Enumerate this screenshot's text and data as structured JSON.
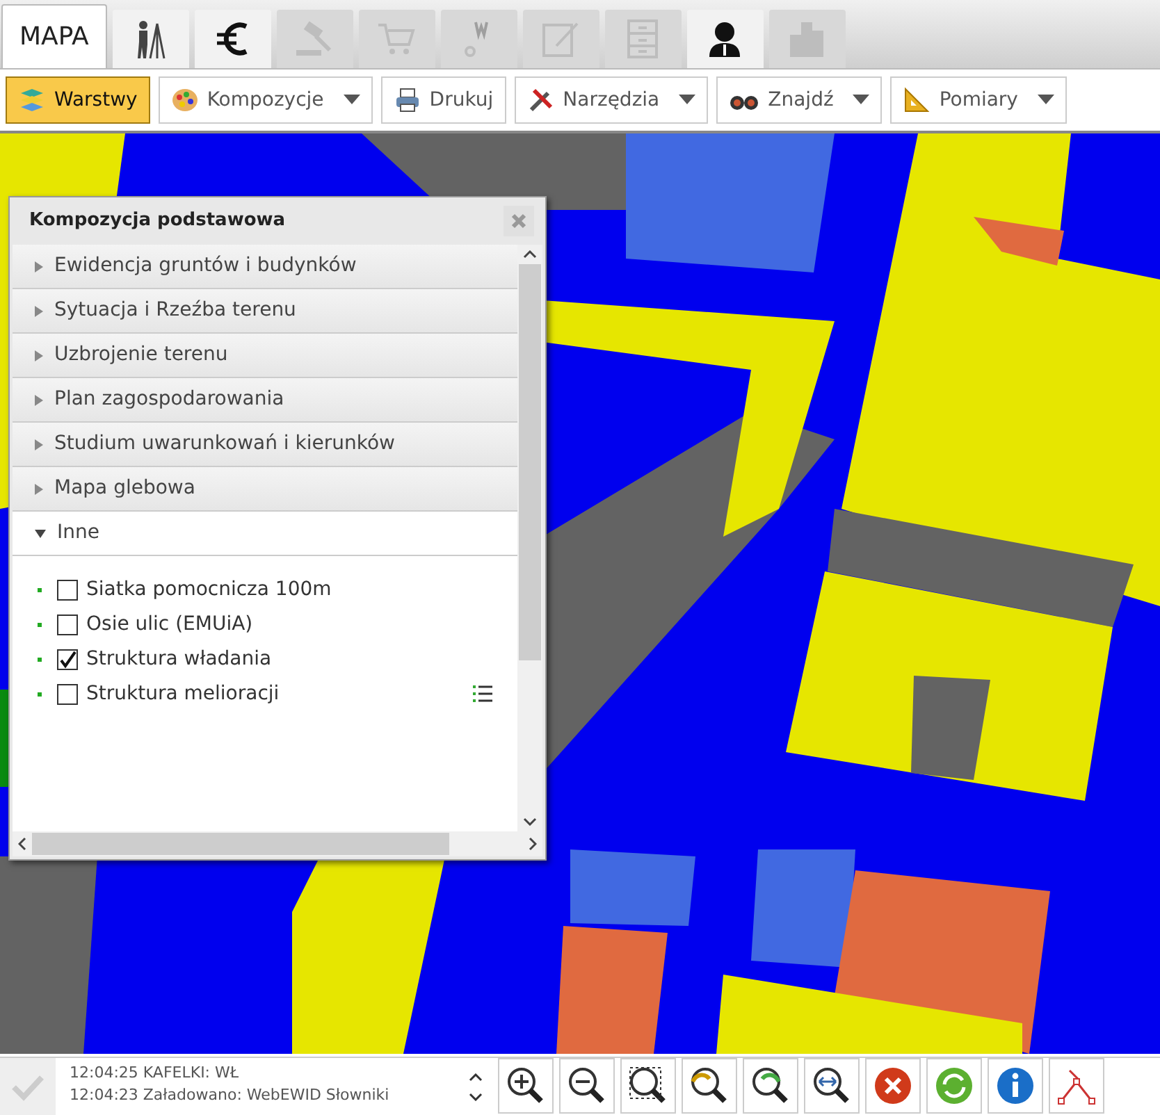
{
  "tabs": [
    {
      "label": "MAPA",
      "selected": true,
      "disabled": false
    },
    {
      "selected": false,
      "disabled": false
    },
    {
      "selected": false,
      "disabled": false
    },
    {
      "selected": false,
      "disabled": true
    },
    {
      "selected": false,
      "disabled": true
    },
    {
      "selected": false,
      "disabled": true
    },
    {
      "selected": false,
      "disabled": true
    },
    {
      "selected": false,
      "disabled": true
    },
    {
      "selected": false,
      "disabled": false
    },
    {
      "selected": false,
      "disabled": true
    }
  ],
  "toolbar": [
    {
      "label": "Warstwy",
      "selected": true,
      "dropdown": false
    },
    {
      "label": "Kompozycje",
      "selected": false,
      "dropdown": true
    },
    {
      "label": "Drukuj",
      "selected": false,
      "dropdown": false
    },
    {
      "label": "Narzędzia",
      "selected": false,
      "dropdown": true
    },
    {
      "label": "Znajdź",
      "selected": false,
      "dropdown": true
    },
    {
      "label": "Pomiary",
      "selected": false,
      "dropdown": true
    }
  ],
  "panel": {
    "title": "Kompozycja podstawowa",
    "sections": [
      {
        "label": "Ewidencja gruntów i budynków",
        "expanded": false
      },
      {
        "label": "Sytuacja i Rzeźba terenu",
        "expanded": false
      },
      {
        "label": "Uzbrojenie terenu",
        "expanded": false
      },
      {
        "label": "Plan zagospodarowania",
        "expanded": false
      },
      {
        "label": "Studium uwarunkowań i kierunków",
        "expanded": false
      },
      {
        "label": "Mapa glebowa",
        "expanded": false
      },
      {
        "label": "Inne",
        "expanded": true,
        "children": [
          {
            "label": "Siatka pomocnicza 100m",
            "checked": false,
            "legend": false
          },
          {
            "label": "Osie ulic (EMUiA)",
            "checked": false,
            "legend": false
          },
          {
            "label": "Struktura władania",
            "checked": true,
            "legend": false
          },
          {
            "label": "Struktura melioracji",
            "checked": false,
            "legend": true
          }
        ]
      }
    ]
  },
  "status_log": [
    "12:04:25 KAFELKI: WŁ",
    "12:04:23 Załadowano: WebEWID Słowniki"
  ]
}
